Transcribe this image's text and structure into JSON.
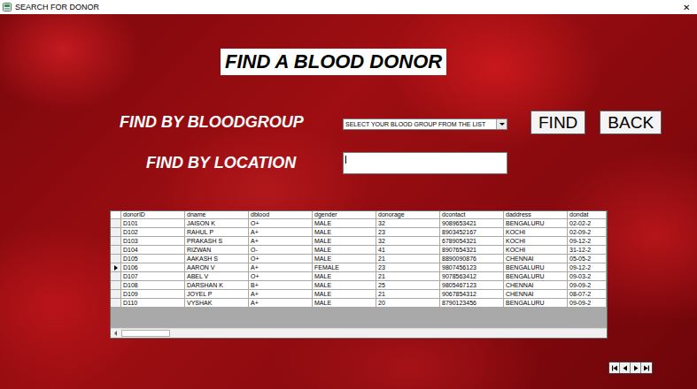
{
  "window": {
    "title": "SEARCH FOR DONOR",
    "close": "✕"
  },
  "heading": "FIND A BLOOD DONOR",
  "search": {
    "bloodgroup_label": "FIND BY BLOODGROUP",
    "bloodgroup_placeholder": "SELECT YOUR BLOOD GROUP FROM THE LIST",
    "location_label": "FIND BY LOCATION",
    "location_value": "",
    "location_focused": true
  },
  "buttons": [
    {
      "label": "FIND"
    },
    {
      "label": "BACK"
    }
  ],
  "table": {
    "columns": [
      "donorID",
      "dname",
      "dblood",
      "dgender",
      "donorage",
      "dcontact",
      "daddress",
      "dondat"
    ],
    "rows": [
      {
        "selected": false,
        "cells": [
          "D101",
          "JAISON K",
          "O+",
          "MALE",
          "32",
          "9089653421",
          "BENGALURU",
          "02-02-2"
        ]
      },
      {
        "selected": false,
        "cells": [
          "D102",
          "RAHUL P",
          "A+",
          "MALE",
          "23",
          "8903452167",
          "KOCHI",
          "02-09-2"
        ]
      },
      {
        "selected": false,
        "cells": [
          "D103",
          "PRAKASH S",
          "A+",
          "MALE",
          "32",
          "6789054321",
          "KOCHI",
          "09-12-2"
        ]
      },
      {
        "selected": false,
        "cells": [
          "D104",
          "RIZWAN",
          "O-",
          "MALE",
          "41",
          "8907654321",
          "KOCHI",
          "31-12-2"
        ]
      },
      {
        "selected": false,
        "cells": [
          "D105",
          "AAKASH S",
          "O+",
          "MALE",
          "21",
          "8890090876",
          "CHENNAI",
          "05-05-2"
        ]
      },
      {
        "selected": true,
        "cells": [
          "D106",
          "AARON V",
          "A+",
          "FEMALE",
          "23",
          "9807456123",
          "BENGALURU",
          "09-12-2"
        ]
      },
      {
        "selected": false,
        "cells": [
          "D107",
          "ABEL V",
          "O+",
          "MALE",
          "21",
          "9078563412",
          "BENGALURU",
          "09-03-2"
        ]
      },
      {
        "selected": false,
        "cells": [
          "D108",
          "DARSHAN K",
          "B+",
          "MALE",
          "25",
          "9805467123",
          "CHENNAI",
          "09-09-2"
        ]
      },
      {
        "selected": false,
        "cells": [
          "D109",
          "JOYEL P",
          "A+",
          "MALE",
          "21",
          "9067854312",
          "CHENNAI",
          "08-07-2"
        ]
      },
      {
        "selected": false,
        "cells": [
          "D110",
          "VYSHAK",
          "A+",
          "MALE",
          "20",
          "8790123456",
          "BENGALURU",
          "09-09-2"
        ]
      }
    ]
  }
}
